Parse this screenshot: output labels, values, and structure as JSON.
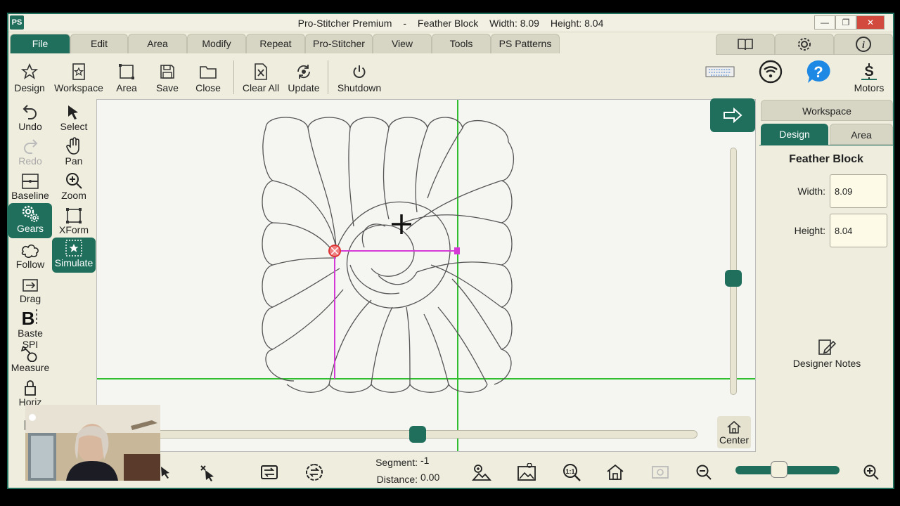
{
  "window": {
    "logo": "PS",
    "app_name": "Pro-Stitcher Premium",
    "separator": "-",
    "design_name": "Feather Block",
    "width_text": "Width: 8.09",
    "height_text": "Height: 8.04",
    "minimize": "—",
    "restore": "❐",
    "close": "✕"
  },
  "tabs": [
    {
      "label": "File",
      "active": true
    },
    {
      "label": "Edit"
    },
    {
      "label": "Area"
    },
    {
      "label": "Modify"
    },
    {
      "label": "Repeat"
    },
    {
      "label": "Pro-Stitcher"
    },
    {
      "label": "View"
    },
    {
      "label": "Tools"
    },
    {
      "label": "PS Patterns"
    }
  ],
  "right_tabs": [
    {
      "icon": "book-icon"
    },
    {
      "icon": "gear-icon"
    },
    {
      "icon": "info-icon"
    }
  ],
  "toolbar": {
    "design": "Design",
    "workspace": "Workspace",
    "area": "Area",
    "save": "Save",
    "close": "Close",
    "clear_all": "Clear All",
    "update": "Update",
    "shutdown": "Shutdown",
    "motors": "Motors"
  },
  "left_tools": [
    {
      "label": "Undo",
      "icon": "undo-icon"
    },
    {
      "label": "Select",
      "icon": "select-arrow-icon"
    },
    {
      "label": "Redo",
      "icon": "redo-icon",
      "disabled": true
    },
    {
      "label": "Pan",
      "icon": "hand-icon"
    },
    {
      "label": "Baseline",
      "icon": "baseline-icon"
    },
    {
      "label": "Zoom",
      "icon": "zoom-icon"
    },
    {
      "label": "Gears",
      "icon": "gears-icon",
      "active": true
    },
    {
      "label": "XForm",
      "icon": "xform-icon"
    },
    {
      "label": "Follow",
      "icon": "follow-icon"
    },
    {
      "label": "Simulate",
      "icon": "simulate-icon",
      "active": true
    },
    {
      "label": "Drag",
      "icon": "drag-icon"
    },
    {
      "label": "Baste SPI",
      "icon": "baste-icon"
    },
    {
      "label": "Measure",
      "icon": "measure-icon"
    },
    {
      "label": "Horiz",
      "icon": "lock-icon"
    },
    {
      "label": "V",
      "icon": "lock-icon"
    }
  ],
  "right_panel": {
    "workspace_tab": "Workspace",
    "design_tab": "Design",
    "area_tab": "Area",
    "title": "Feather Block",
    "width_label": "Width:",
    "width_value": "8.09",
    "height_label": "Height:",
    "height_value": "8.04",
    "notes": "Designer Notes"
  },
  "canvas": {
    "center_label": "Center",
    "vertical_zoom_level": 0.52,
    "horizontal_scroll_level": 0.5
  },
  "status": {
    "segment_label": "Segment:",
    "segment_value": "-1",
    "distance_label": "Distance:",
    "distance_value": "0.00",
    "zoom_level": 0.42
  },
  "colors": {
    "accent": "#1f6f5c",
    "background": "#efeddd",
    "guide_line": "#2fbf2f",
    "selection": "#d63ad6",
    "help": "#1e88e5"
  }
}
